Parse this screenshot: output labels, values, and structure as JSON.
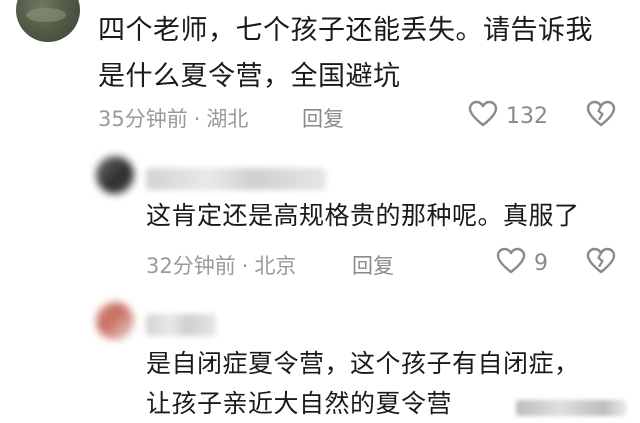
{
  "comments": [
    {
      "text_line1": "四个老师，七个孩子还能丢失。请告诉我",
      "text_line2": "是什么夏令营，全国避坑",
      "time": "35分钟前",
      "dot": "·",
      "location": "湖北",
      "reply_label": "回复",
      "likes": "132"
    },
    {
      "text": "这肯定还是高规格贵的那种呢。真服了",
      "time": "32分钟前",
      "dot": "·",
      "location": "北京",
      "reply_label": "回复",
      "likes": "9"
    },
    {
      "text_line1": "是自闭症夏令营，这个孩子有自闭症，",
      "text_line2": "让孩子亲近大自然的夏令营"
    }
  ],
  "icons": {
    "like": "heart-outline-icon",
    "dislike": "broken-heart-outline-icon"
  },
  "colors": {
    "text": "#1a1a1a",
    "meta": "#9a9a9a",
    "icon": "#8a8a8a"
  }
}
